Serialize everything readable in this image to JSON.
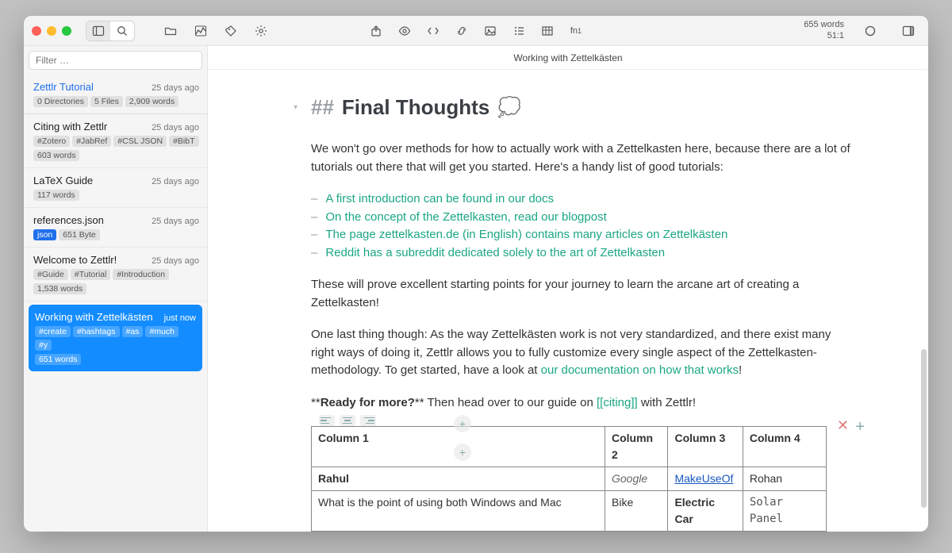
{
  "status": {
    "words": "655 words",
    "cursor": "51:1"
  },
  "doc_title": "Working with Zettelkästen",
  "filter_placeholder": "Filter …",
  "sidebar": {
    "items": [
      {
        "title": "Zettlr Tutorial",
        "time": "25 days ago",
        "is_link_title": true,
        "pills": [
          "0 Directories",
          "5 Files",
          "2,909 words"
        ]
      },
      {
        "title": "Citing with Zettlr",
        "time": "25 days ago",
        "pills": [
          "#Zotero",
          "#JabRef",
          "#CSL JSON",
          "#BibT"
        ],
        "footer": "603 words"
      },
      {
        "title": "LaTeX Guide",
        "time": "25 days ago",
        "footer": "117 words"
      },
      {
        "title": "references.json",
        "time": "25 days ago",
        "pills_special": [
          {
            "label": "json",
            "blue": true
          },
          {
            "label": "651 Byte"
          }
        ]
      },
      {
        "title": "Welcome to Zettlr!",
        "time": "25 days ago",
        "pills": [
          "#Guide",
          "#Tutorial",
          "#Introduction"
        ],
        "footer": "1,538 words"
      },
      {
        "title": "Working with Zettelkästen",
        "time": "just now",
        "selected": true,
        "pills": [
          "#create",
          "#hashtags",
          "#as",
          "#much",
          "#y"
        ],
        "footer": "651 words"
      }
    ]
  },
  "editor": {
    "heading_marker": "##",
    "heading_text": "Final Thoughts",
    "cloud_emoji": "💭",
    "para1": "We won't go over methods for how to actually work with a Zettelkasten here, because there are a lot of tutorials out there that will get you started. Here's a handy list of good tutorials:",
    "bullets": [
      "A first introduction can be found in our docs",
      "On the concept of the Zettelkasten, read our blogpost",
      "The page zettelkasten.de (in English) contains many articles on Zettelkästen",
      "Reddit has a subreddit dedicated solely to the art of Zettelkasten"
    ],
    "para2": "These will prove excellent starting points for your journey to learn the arcane art of creating a Zettelkasten!",
    "para3_a": "One last thing though: As the way Zettelkästen work is not very standardized, and there exist many right ways of doing it, Zettlr allows you to fully customize every single aspect of the Zettelkasten-methodology. To get started, have a look at ",
    "para3_link": "our documentation on how that works",
    "para3_b": "!",
    "ready_prefix": "**",
    "ready_text": "Ready for more?",
    "ready_suffix": "**",
    "ready_after": " Then head over to our guide on ",
    "wikilink_open": "[[",
    "wikilink_text": "citing",
    "wikilink_close": "]]",
    "ready_tail": " with Zettlr!",
    "table": {
      "headers": [
        "Column 1",
        "Column 2",
        "Column 3",
        "Column 4"
      ],
      "rows": [
        [
          "Rahul",
          "Google",
          "MakeUseOf",
          "Rohan"
        ],
        [
          "What is the point of using both Windows and Mac",
          "Bike",
          "Electric Car",
          "Solar Panel"
        ]
      ]
    }
  }
}
